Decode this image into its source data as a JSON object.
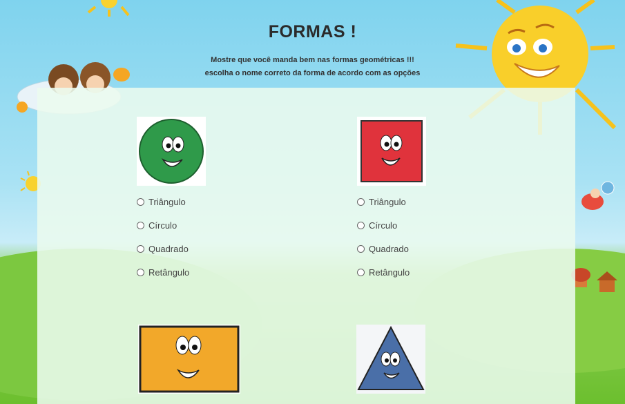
{
  "page": {
    "title": "FORMAS !",
    "subtitle_line1": "Mostre que você manda bem nas formas geométricas !!!",
    "subtitle_line2": "escolha o nome correto da forma de acordo com as opções"
  },
  "questions": [
    {
      "shape": "circle",
      "color": "#2f9a4a",
      "options": [
        "Triângulo",
        "Círculo",
        "Quadrado",
        "Retângulo"
      ]
    },
    {
      "shape": "square",
      "color": "#e0333c",
      "options": [
        "Triângulo",
        "Círculo",
        "Quadrado",
        "Retângulo"
      ]
    },
    {
      "shape": "rectangle",
      "color": "#f2a82a"
    },
    {
      "shape": "triangle",
      "color": "#4a6fa8"
    }
  ]
}
